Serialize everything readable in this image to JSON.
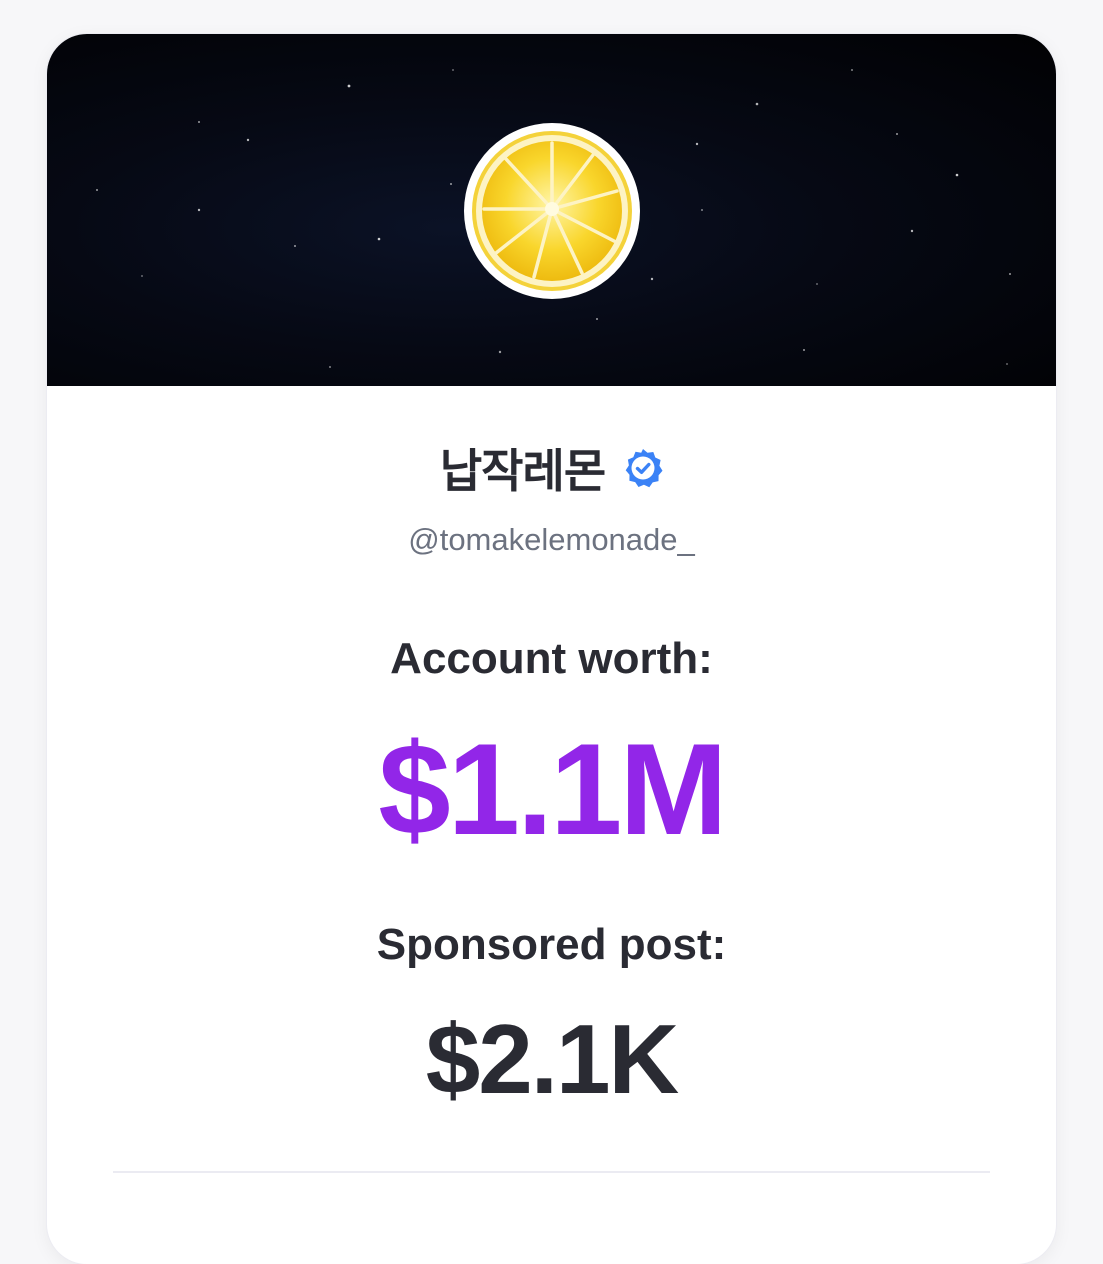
{
  "profile": {
    "display_name": "납작레몬",
    "verified": true,
    "handle": "@tomakelemonade_",
    "avatar_icon": "lemon-slice-avatar",
    "banner_icon": "starry-night-banner"
  },
  "stats": {
    "account_worth_label": "Account worth:",
    "account_worth_value": "$1.1M",
    "sponsored_post_label": "Sponsored post:",
    "sponsored_post_value": "$2.1K"
  },
  "colors": {
    "accent": "#9226e8",
    "verified_badge": "#3b82f6",
    "text_dark": "#2a2b33",
    "text_muted": "#6c7280"
  }
}
